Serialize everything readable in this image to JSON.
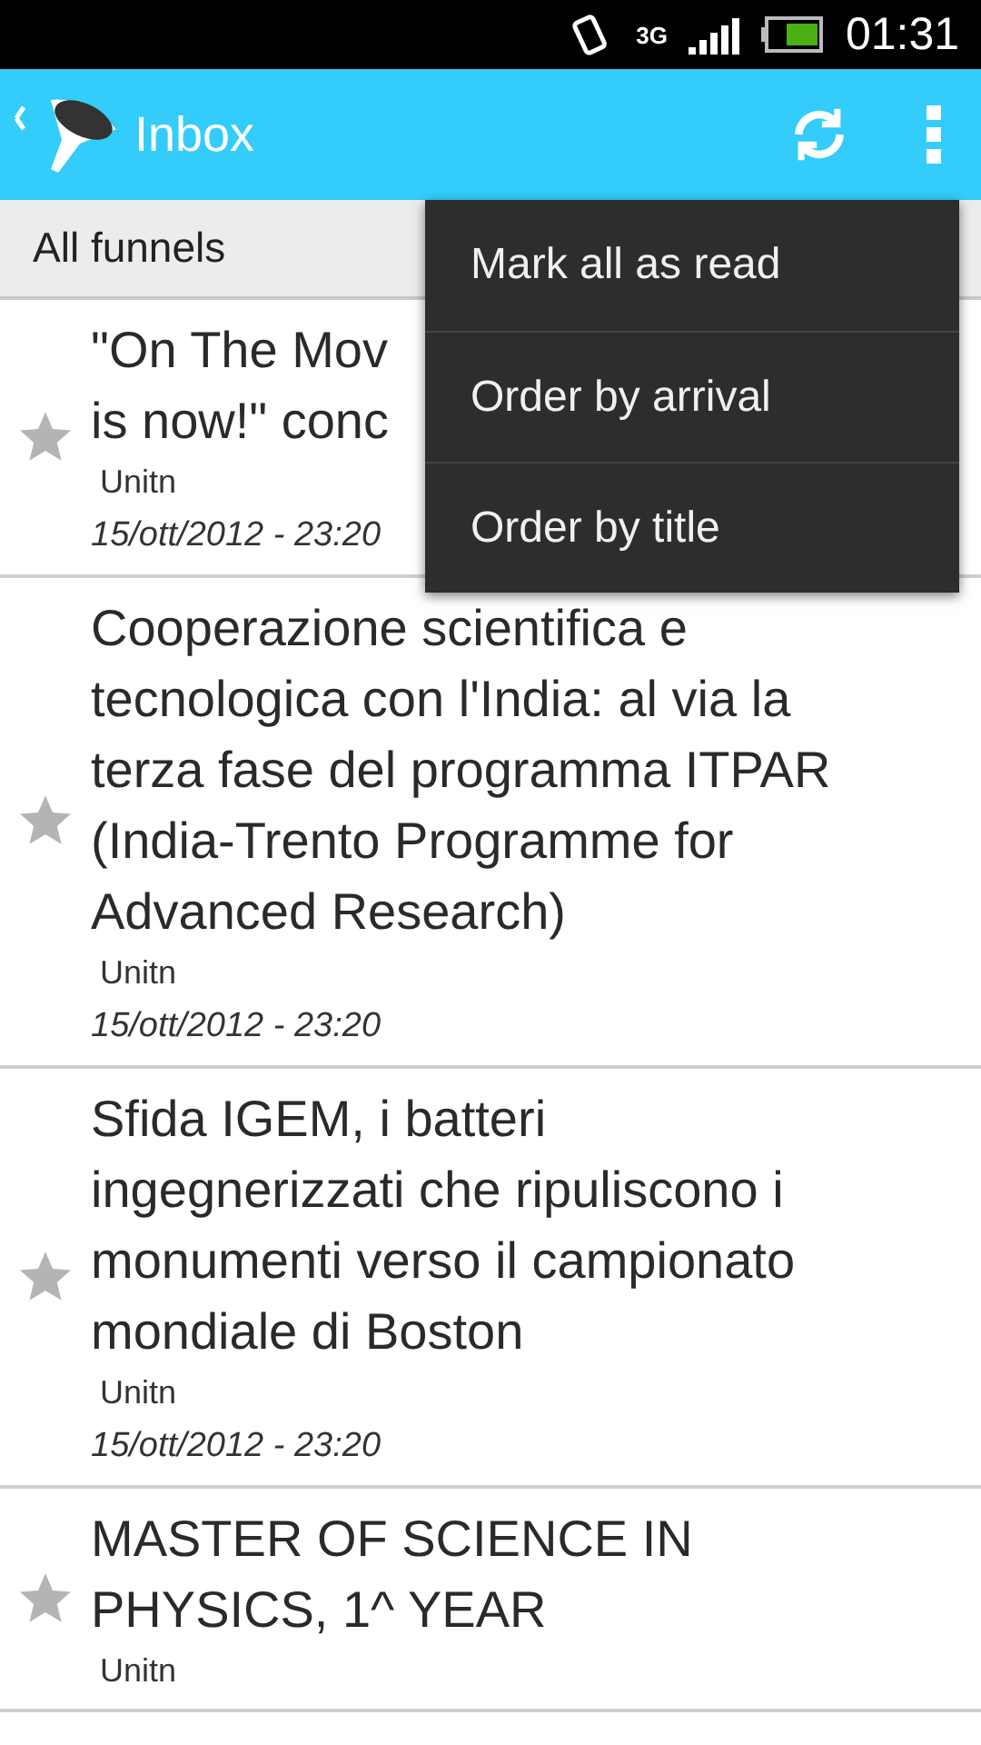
{
  "status_bar": {
    "network": "3G",
    "time": "01:31"
  },
  "action_bar": {
    "title": "Inbox"
  },
  "filter": {
    "label": "All funnels"
  },
  "items": [
    {
      "title_lines": [
        "\"On The Mov",
        "is now!\" conc"
      ],
      "source": "Unitn",
      "date": "15/ott/2012 - 23:20",
      "starred": false
    },
    {
      "title_lines": [
        "Cooperazione scientifica e",
        "tecnologica con l'India: al via la",
        "terza fase del programma ITPAR",
        "(India-Trento Programme for",
        "Advanced Research)"
      ],
      "source": "Unitn",
      "date": "15/ott/2012 - 23:20",
      "starred": false
    },
    {
      "title_lines": [
        "Sfida IGEM, i batteri",
        "ingegnerizzati che ripuliscono i",
        "monumenti verso il campionato",
        "mondiale di Boston"
      ],
      "source": "Unitn",
      "date": "15/ott/2012 - 23:20",
      "starred": false
    },
    {
      "title_lines": [
        "MASTER OF SCIENCE IN",
        "PHYSICS, 1^ YEAR"
      ],
      "source": "Unitn",
      "starred": false
    }
  ],
  "menu": [
    "Mark all as read",
    "Order by arrival",
    "Order by title"
  ]
}
